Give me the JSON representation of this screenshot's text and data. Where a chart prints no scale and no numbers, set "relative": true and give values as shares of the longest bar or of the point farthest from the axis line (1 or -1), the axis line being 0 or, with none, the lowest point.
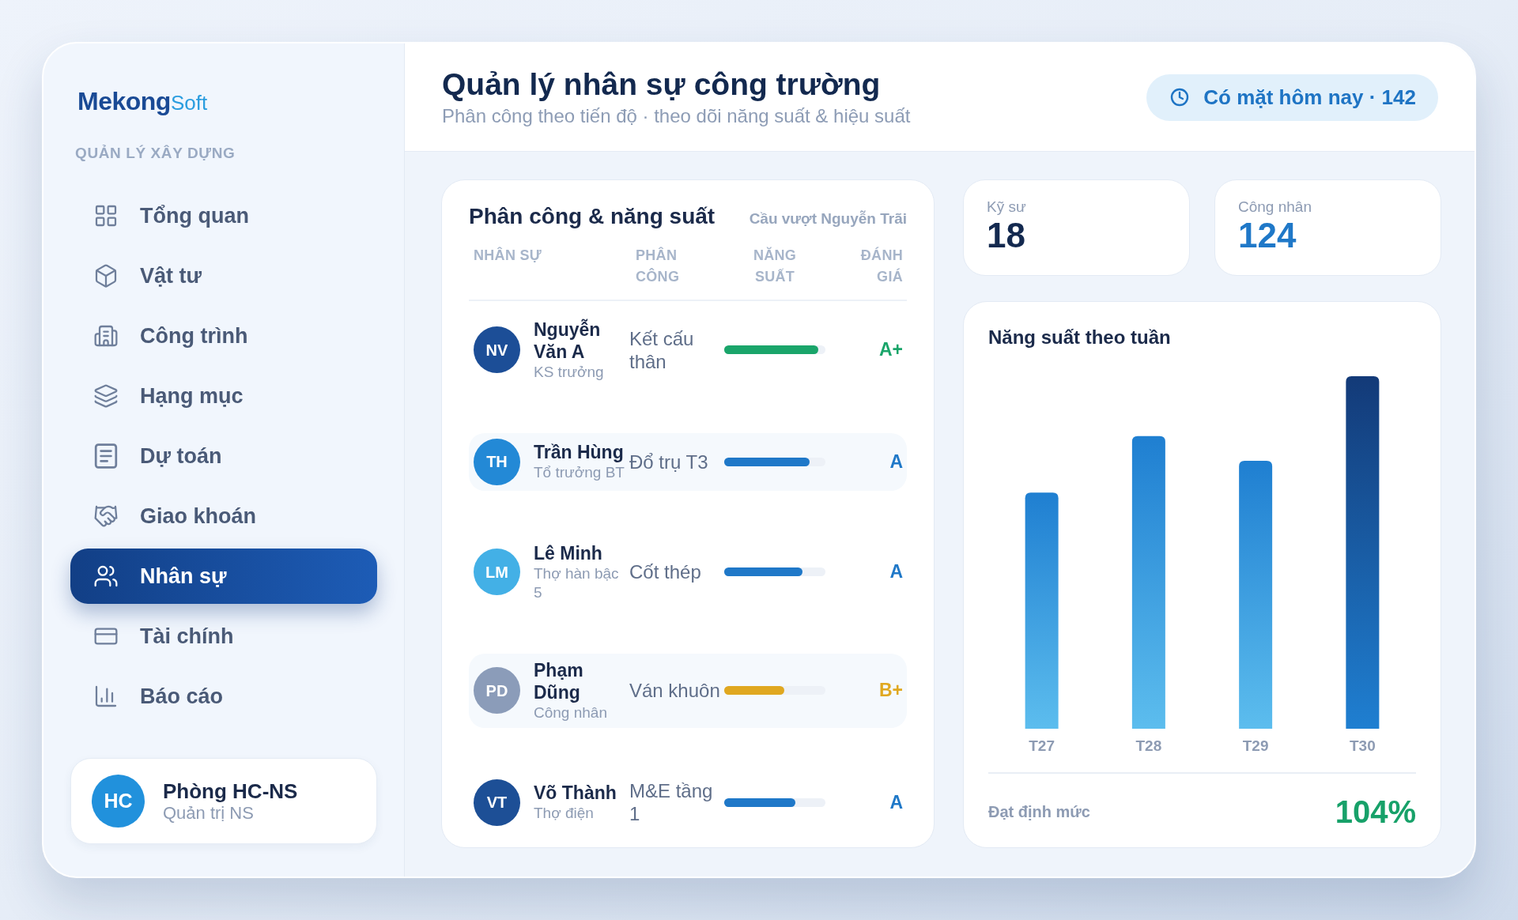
{
  "sidebar": {
    "logo": {
      "primary": "Mekong",
      "secondary": "Soft"
    },
    "section_label": "QUẢN LÝ XÂY DỰNG",
    "items": [
      {
        "label": "Tổng quan",
        "selected": false
      },
      {
        "label": "Vật tư",
        "selected": false
      },
      {
        "label": "Công trình",
        "selected": false
      },
      {
        "label": "Hạng mục",
        "selected": false
      },
      {
        "label": "Dự toán",
        "selected": false
      },
      {
        "label": "Giao khoán",
        "selected": false
      },
      {
        "label": "Nhân sự",
        "selected": true
      },
      {
        "label": "Tài chính",
        "selected": false
      },
      {
        "label": "Báo cáo",
        "selected": false
      }
    ],
    "account": {
      "initials": "HC",
      "name": "Phòng HC-NS",
      "role": "Quản trị NS"
    }
  },
  "header": {
    "title": "Quản lý nhân sự công trường",
    "subtitle": "Phân công theo tiến độ · theo dõi năng suất & hiệu suất",
    "attendance_badge": "Có mặt hôm nay · 142"
  },
  "assignment_table": {
    "title": "Phân công & năng suất",
    "project": "Cầu vượt Nguyễn Trãi",
    "columns": [
      "NHÂN SỰ",
      "PHÂN CÔNG",
      "NĂNG SUẤT",
      "ĐÁNH GIÁ"
    ],
    "rows": [
      {
        "avatar": {
          "initials": "NV",
          "color": "#1c4e97"
        },
        "name": "Nguyễn Văn A",
        "role": "KS trưởng",
        "assignment": "Kết cấu thân",
        "productivity": {
          "level": 0.93,
          "color": "#1aa56a"
        },
        "grade": "A+"
      },
      {
        "avatar": {
          "initials": "TH",
          "color": "#2389d6"
        },
        "name": "Trần Hùng",
        "role": "Tổ trưởng BT",
        "assignment": "Đổ trụ T3",
        "productivity": {
          "level": 0.84,
          "color": "#1f78c8"
        },
        "grade": "A"
      },
      {
        "avatar": {
          "initials": "LM",
          "color": "#43b0e6"
        },
        "name": "Lê Minh",
        "role": "Thợ hàn bậc 5",
        "assignment": "Cốt thép",
        "productivity": {
          "level": 0.77,
          "color": "#1f78c8"
        },
        "grade": "A"
      },
      {
        "avatar": {
          "initials": "PD",
          "color": "#8b9cb9"
        },
        "name": "Phạm Dũng",
        "role": "Công nhân",
        "assignment": "Ván khuôn",
        "productivity": {
          "level": 0.59,
          "color": "#e0a820"
        },
        "grade": "B+"
      },
      {
        "avatar": {
          "initials": "VT",
          "color": "#1d4f96"
        },
        "name": "Võ Thành",
        "role": "Thợ điện",
        "assignment": "M&E tầng 1",
        "productivity": {
          "level": 0.7,
          "color": "#1f78c8"
        },
        "grade": "A"
      }
    ]
  },
  "stats": [
    {
      "label": "Kỹ sư",
      "value": "18",
      "color": "#13294f"
    },
    {
      "label": "Công nhân",
      "value": "124",
      "color": "#1f78c8"
    }
  ],
  "weekly_chart": {
    "chart_data": {
      "type": "bar",
      "title": "Năng suất theo tuần",
      "categories": [
        "T27",
        "T28",
        "T29",
        "T30"
      ],
      "values": [
        0.67,
        0.83,
        0.76,
        1
      ],
      "relative": true
    },
    "bars": [
      {
        "selected": false
      },
      {
        "selected": false
      },
      {
        "selected": false
      },
      {
        "selected": true
      }
    ],
    "footer_label": "Đạt định mức",
    "footer_value": "104%"
  }
}
